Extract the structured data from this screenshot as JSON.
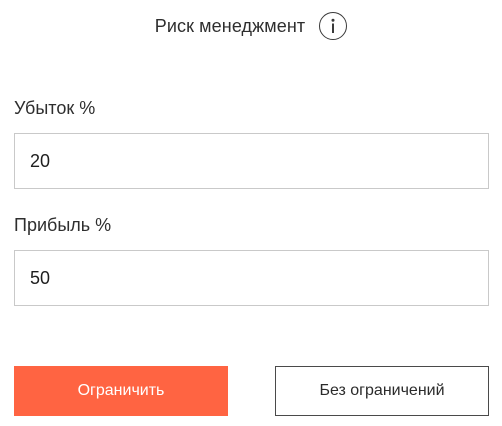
{
  "header": {
    "title": "Риск менеджмент",
    "info_icon": "info-icon"
  },
  "form": {
    "loss": {
      "label": "Убыток %",
      "value": "20"
    },
    "profit": {
      "label": "Прибыль %",
      "value": "50"
    }
  },
  "actions": {
    "limit_label": "Ограничить",
    "no_limit_label": "Без ограничений"
  },
  "colors": {
    "accent": "#ff6442",
    "border": "#c9c9c9",
    "text": "#2e2e2e"
  }
}
